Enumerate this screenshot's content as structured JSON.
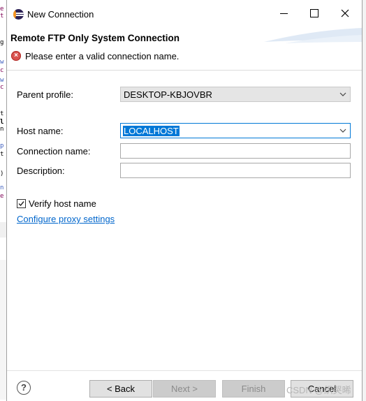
{
  "window": {
    "title": "New Connection",
    "minimize_icon": "minimize-icon",
    "maximize_icon": "maximize-icon",
    "close_icon": "close-icon",
    "app_icon": "eclipse-icon"
  },
  "banner": {
    "title": "Remote FTP Only System Connection",
    "error_message": "Please enter a valid connection name.",
    "error_icon": "error-icon"
  },
  "form": {
    "parent_profile": {
      "label": "Parent profile:",
      "value": "DESKTOP-KBJOVBR"
    },
    "host_name": {
      "label": "Host name:",
      "value": "LOCALHOST"
    },
    "connection_name": {
      "label": "Connection name:",
      "value": ""
    },
    "description": {
      "label": "Description:",
      "value": ""
    },
    "verify_host": {
      "label": "Verify host name",
      "checked": true
    },
    "proxy_link": "Configure proxy settings"
  },
  "footer": {
    "help_icon": "help-icon",
    "back": "< Back",
    "next": "Next >",
    "finish": "Finish",
    "cancel": "Cancel"
  },
  "watermark": "CSDN @织哭晞",
  "colors": {
    "selection": "#0078d7",
    "link": "#0066cc",
    "error": "#d9534f"
  }
}
